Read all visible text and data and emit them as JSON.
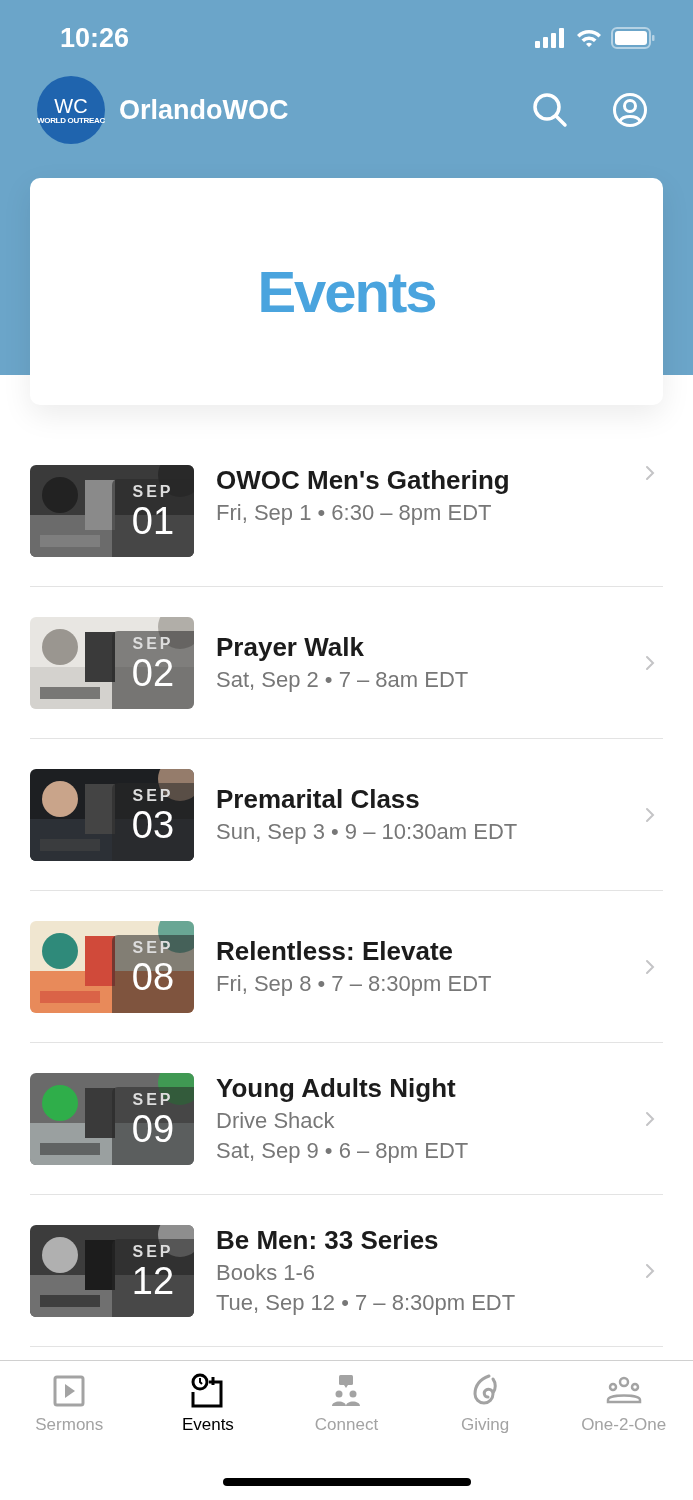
{
  "status_bar": {
    "time": "10:26"
  },
  "header": {
    "logo": {
      "mark": "WC",
      "caption": "WORLD OUTREAC"
    },
    "title": "OrlandoWOC"
  },
  "banner": {
    "title": "Events"
  },
  "events": [
    {
      "month": "SEP",
      "day": "01",
      "title": "OWOC Men's Gathering",
      "details": [
        "Fri, Sep 1 • 6:30 – 8pm EDT"
      ]
    },
    {
      "month": "SEP",
      "day": "02",
      "title": "Prayer Walk",
      "details": [
        "Sat, Sep 2 • 7 – 8am EDT"
      ]
    },
    {
      "month": "SEP",
      "day": "03",
      "title": "Premarital Class",
      "details": [
        "Sun, Sep 3 • 9 – 10:30am EDT"
      ]
    },
    {
      "month": "SEP",
      "day": "08",
      "title": "Relentless: Elevate",
      "details": [
        "Fri, Sep 8 • 7 – 8:30pm EDT"
      ]
    },
    {
      "month": "SEP",
      "day": "09",
      "title": "Young Adults Night",
      "details": [
        "Drive Shack",
        "Sat, Sep 9 • 6 – 8pm EDT"
      ]
    },
    {
      "month": "SEP",
      "day": "12",
      "title": "Be Men: 33 Series",
      "details": [
        "Books 1-6",
        "Tue, Sep 12 • 7 – 8:30pm EDT"
      ]
    }
  ],
  "tabs": [
    {
      "label": "Sermons",
      "selected": false
    },
    {
      "label": "Events",
      "selected": true
    },
    {
      "label": "Connect",
      "selected": false
    },
    {
      "label": "Giving",
      "selected": false
    },
    {
      "label": "One-2-One",
      "selected": false
    }
  ]
}
